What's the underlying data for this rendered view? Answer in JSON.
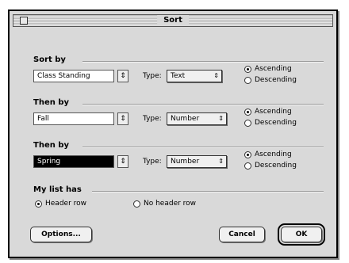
{
  "window": {
    "title": "Sort"
  },
  "groups": [
    {
      "label": "Sort by",
      "field": "Class Standing",
      "type_label": "Type:",
      "type_value": "Text",
      "order": [
        {
          "label": "Ascending",
          "checked": true
        },
        {
          "label": "Descending",
          "checked": false
        }
      ]
    },
    {
      "label": "Then by",
      "field": "Fall",
      "type_label": "Type:",
      "type_value": "Number",
      "order": [
        {
          "label": "Ascending",
          "checked": true
        },
        {
          "label": "Descending",
          "checked": false
        }
      ]
    },
    {
      "label": "Then by",
      "field": "Spring",
      "type_label": "Type:",
      "type_value": "Number",
      "order": [
        {
          "label": "Ascending",
          "checked": true
        },
        {
          "label": "Descending",
          "checked": false
        }
      ]
    }
  ],
  "header": {
    "label": "My list has",
    "options": [
      {
        "label": "Header row",
        "checked": true
      },
      {
        "label": "No header row",
        "checked": false
      }
    ]
  },
  "buttons": {
    "options": "Options...",
    "cancel": "Cancel",
    "ok": "OK"
  }
}
